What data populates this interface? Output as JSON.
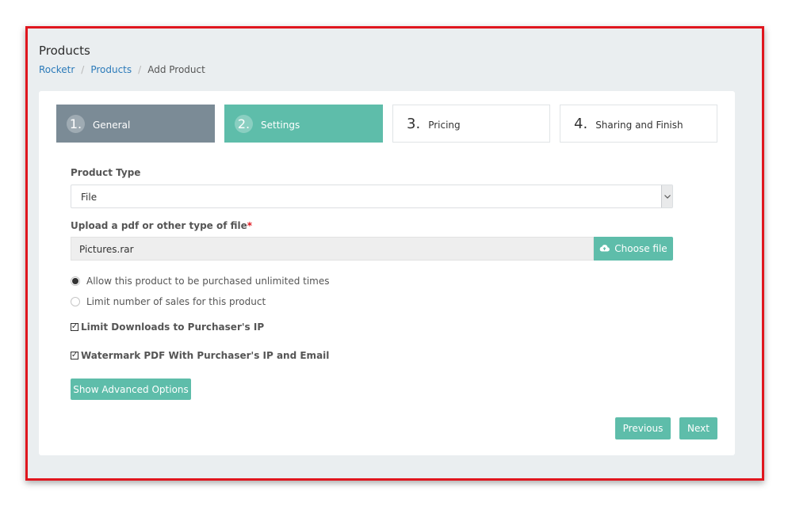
{
  "header": {
    "title": "Products",
    "breadcrumb": [
      "Rocketr",
      "Products",
      "Add Product"
    ],
    "breadcrumb_sep": "/"
  },
  "steps": [
    {
      "num": "1.",
      "label": "General"
    },
    {
      "num": "2.",
      "label": "Settings"
    },
    {
      "num": "3.",
      "label": "Pricing"
    },
    {
      "num": "4.",
      "label": "Sharing and Finish"
    }
  ],
  "form": {
    "product_type_label": "Product Type",
    "product_type_value": "File",
    "upload_label": "Upload a pdf or other type of file",
    "upload_required_mark": "*",
    "file_value": "Pictures.rar",
    "choose_file_label": "Choose file",
    "radio_unlimited": "Allow this product to be purchased unlimited times",
    "radio_limit": "Limit number of sales for this product",
    "check_ip": "Limit Downloads to Purchaser's IP",
    "check_watermark": "Watermark PDF With Purchaser's IP and Email",
    "advanced_button": "Show Advanced Options"
  },
  "nav": {
    "previous": "Previous",
    "next": "Next"
  },
  "colors": {
    "accent": "#5ebdaa",
    "step_done": "#7b8b96",
    "frame_border": "#e0161e",
    "link": "#2b7ab9"
  }
}
